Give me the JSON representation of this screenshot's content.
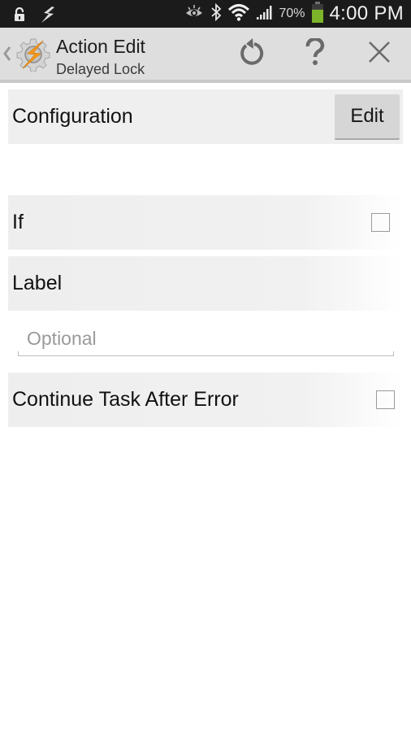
{
  "status_bar": {
    "icons_left": [
      "lock-open-icon",
      "tasker-bolt-icon"
    ],
    "icons_right": [
      "eye-icon",
      "bluetooth-icon",
      "wifi-icon",
      "signal-icon",
      "battery-icon"
    ],
    "battery_percent": "70%",
    "battery_level": 0.7,
    "battery_color": "#7cb42a",
    "time": "4:00 PM"
  },
  "action_bar": {
    "title": "Action Edit",
    "subtitle": "Delayed Lock",
    "app_icon": "tasker-gear-bolt-icon",
    "buttons": {
      "revert": "revert-icon",
      "help": "help-icon",
      "close": "close-icon"
    }
  },
  "sections": {
    "configuration": {
      "label": "Configuration",
      "button_label": "Edit"
    },
    "if": {
      "label": "If",
      "checked": false
    },
    "label": {
      "label": "Label",
      "input_value": "",
      "input_placeholder": "Optional"
    },
    "continue_after_error": {
      "label": "Continue Task After Error",
      "checked": false
    }
  },
  "colors": {
    "status_bar_bg": "#1b1b1b",
    "action_bar_bg": "#dedede",
    "accent_orange": "#f39a1e"
  }
}
